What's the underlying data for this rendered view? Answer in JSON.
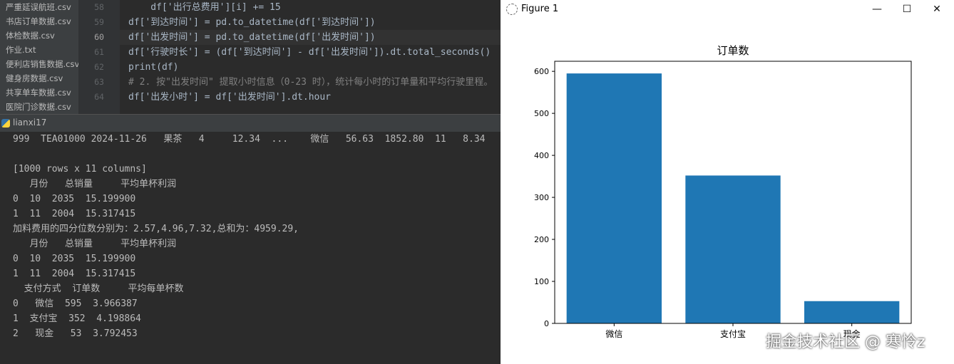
{
  "files": [
    "严重延误航班.csv",
    "书店订单数据.csv",
    "体检数据.csv",
    "作业.txt",
    "便利店销售数据.csv",
    "健身房数据.csv",
    "共享单车数据.csv",
    "医院门诊数据.csv"
  ],
  "editor": {
    "line_numbers": [
      "58",
      "59",
      "60",
      "61",
      "62",
      "63",
      "64"
    ],
    "current_line": "60",
    "lines": [
      "    df['出行总费用'][i] += 15",
      "df['到达时间'] = pd.to_datetime(df['到达时间'])",
      "df['出发时间'] = pd.to_datetime(df['出发时间'])",
      "df['行驶时长'] = (df['到达时间'] - df['出发时间']).dt.total_seconds()",
      "print(df)",
      "# 2. 按\"出发时间\" 提取小时信息（0-23 时），统计每小时的订单量和平均行驶里程。",
      "df['出发小时'] = df['出发时间'].dt.hour"
    ]
  },
  "run": {
    "tab_label": "lianxi17"
  },
  "console": {
    "lines": [
      "999  TEA01000 2024-11-26   果茶   4     12.34  ...    微信   56.63  1852.80  11   8.34",
      "",
      "[1000 rows x 11 columns]",
      "   月份   总销量     平均单杯利润",
      "0  10  2035  15.199900",
      "1  11  2004  15.317415",
      "加料费用的四分位数分别为：2.57,4.96,7.32,总和为：4959.29,",
      "   月份   总销量     平均单杯利润",
      "0  10  2035  15.199900",
      "1  11  2004  15.317415",
      "  支付方式  订单数     平均每单杯数",
      "0   微信  595  3.966387",
      "1  支付宝  352  4.198864",
      "2   现金   53  3.792453"
    ]
  },
  "figure": {
    "window_title": "Figure 1",
    "minimize_glyph": "—",
    "maximize_glyph": "☐",
    "close_glyph": "✕"
  },
  "chart_data": {
    "type": "bar",
    "title": "订单数",
    "categories": [
      "微信",
      "支付宝",
      "现金"
    ],
    "values": [
      595,
      352,
      53
    ],
    "yticks": [
      0,
      100,
      200,
      300,
      400,
      500,
      600
    ],
    "ylim": [
      0,
      624
    ],
    "color": "#1f77b4",
    "grid": false
  },
  "watermark": "掘金技术社区 @ 寒怜z"
}
